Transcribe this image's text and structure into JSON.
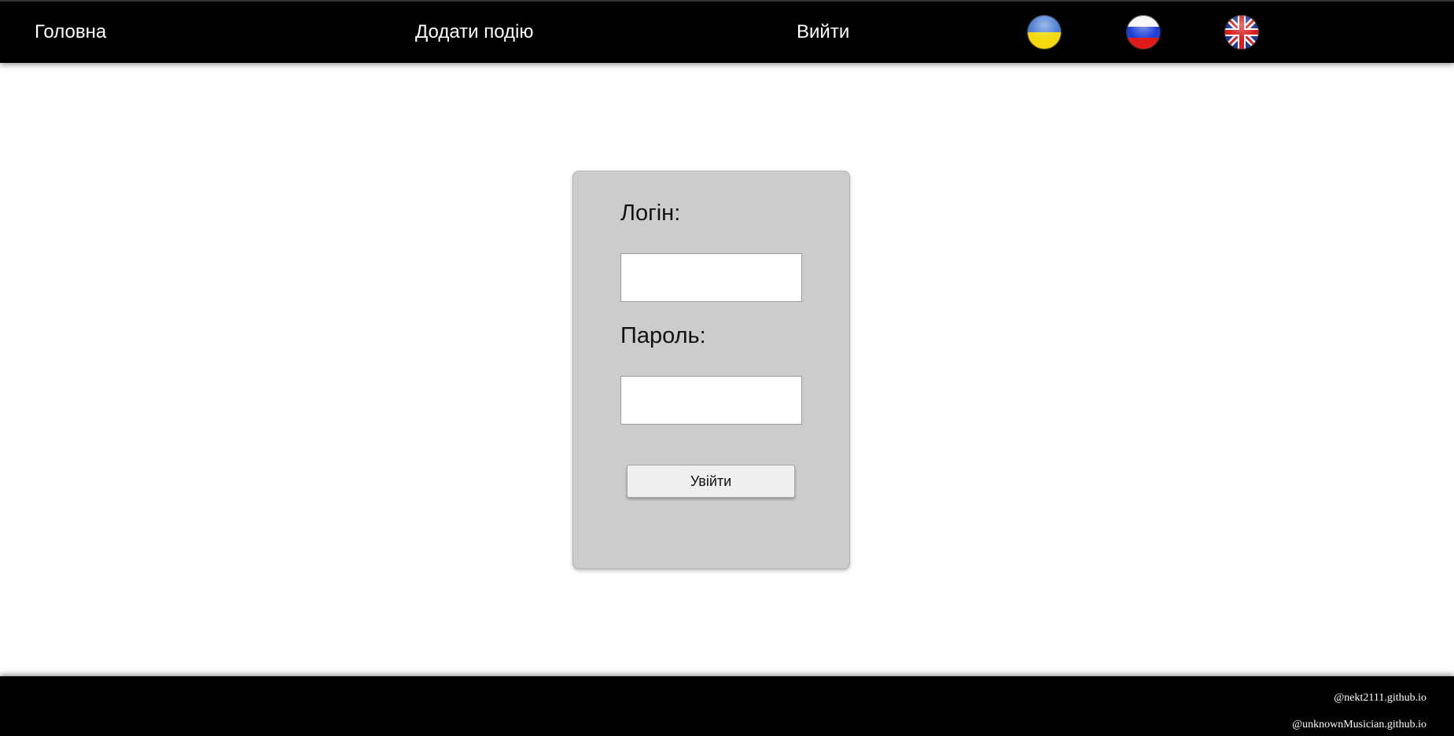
{
  "header": {
    "nav": {
      "home": "Головна",
      "add_event": "Додати подію",
      "logout": "Вийти"
    },
    "languages": [
      {
        "icon": "ukraine-flag-icon",
        "colors": [
          "#4a7fd4",
          "#f5d90a"
        ]
      },
      {
        "icon": "russia-flag-icon",
        "colors": [
          "#ffffff",
          "#1f3fd6",
          "#e01a1a"
        ]
      },
      {
        "icon": "uk-flag-icon",
        "colors": [
          "#1f3a93",
          "#ffffff",
          "#d81e1e"
        ]
      }
    ]
  },
  "login_form": {
    "login_label": "Логін:",
    "login_value": "",
    "password_label": "Пароль:",
    "password_value": "",
    "submit_label": "Увійти"
  },
  "footer": {
    "links": [
      "@nekt2111.github.io",
      "@unknownMusician.github.io"
    ]
  },
  "colors": {
    "bar_background": "#000000",
    "form_background": "#cccccc",
    "page_background": "#ffffff"
  }
}
